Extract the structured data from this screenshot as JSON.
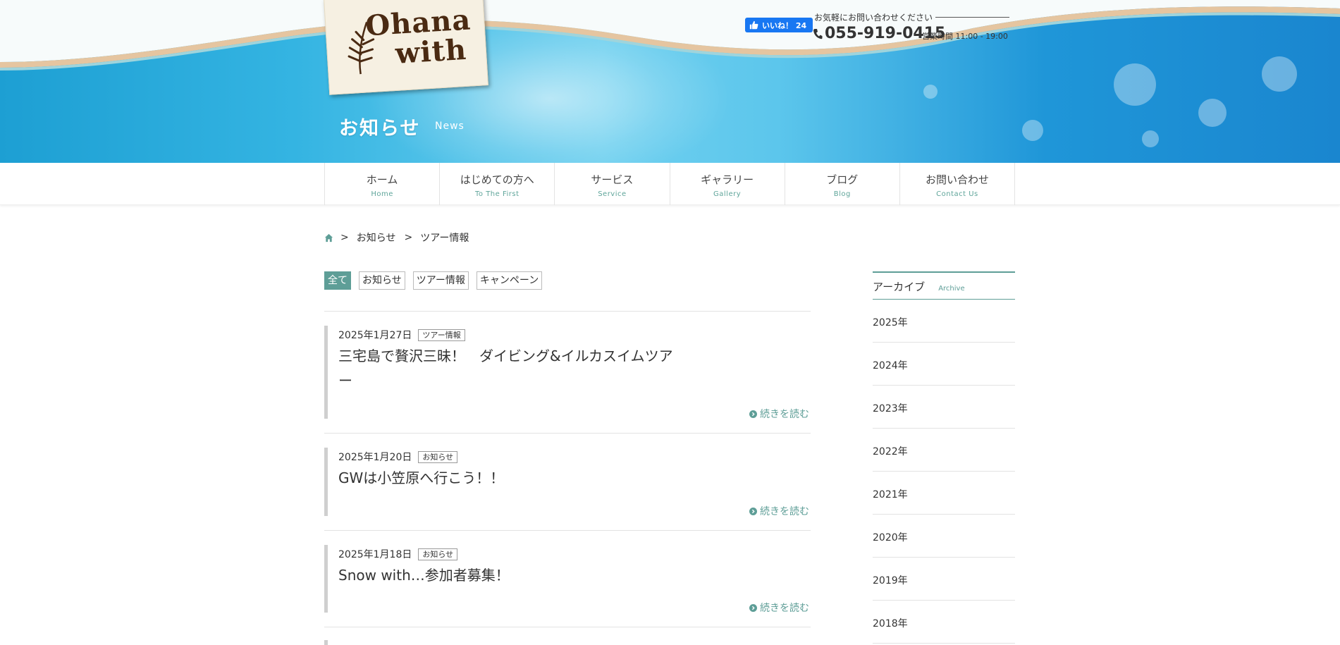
{
  "header": {
    "logo_text_line1": "Ohana",
    "logo_text_line2": "with",
    "page_title": "お知らせ",
    "page_title_en": "News",
    "fb_like_label": "いいね！ 24",
    "contact_lead": "お気軽にお問い合わせください",
    "phone": "055-919-0415",
    "hours": "営業時間 11:00 - 19:00"
  },
  "nav": {
    "items": [
      {
        "jp": "ホーム",
        "en": "Home"
      },
      {
        "jp": "はじめての方へ",
        "en": "To The First"
      },
      {
        "jp": "サービス",
        "en": "Service"
      },
      {
        "jp": "ギャラリー",
        "en": "Gallery"
      },
      {
        "jp": "ブログ",
        "en": "Blog"
      },
      {
        "jp": "お問い合わせ",
        "en": "Contact Us"
      }
    ]
  },
  "breadcrumb": {
    "separator": ">",
    "items": [
      "お知らせ",
      "ツアー情報"
    ]
  },
  "tabs": [
    "全て",
    "お知らせ",
    "ツアー情報",
    "キャンペーン"
  ],
  "posts": [
    {
      "date": "2025年1月27日",
      "category": "ツアー情報",
      "title": "三宅島で贅沢三昧！　ダイビング&イルカスイムツアー",
      "more": "続きを読む"
    },
    {
      "date": "2025年1月20日",
      "category": "お知らせ",
      "title": "GWは小笠原へ行こう！！",
      "more": "続きを読む"
    },
    {
      "date": "2025年1月18日",
      "category": "お知らせ",
      "title": "Snow with…参加者募集！",
      "more": "続きを読む"
    }
  ],
  "sidebar": {
    "title": "アーカイブ",
    "title_en": "Archive",
    "years": [
      "2025年",
      "2024年",
      "2023年",
      "2022年",
      "2021年",
      "2020年",
      "2019年",
      "2018年"
    ]
  },
  "colors": {
    "accent": "#5e9e97",
    "facebook": "#1877f2",
    "sky": "#34b4e2"
  }
}
